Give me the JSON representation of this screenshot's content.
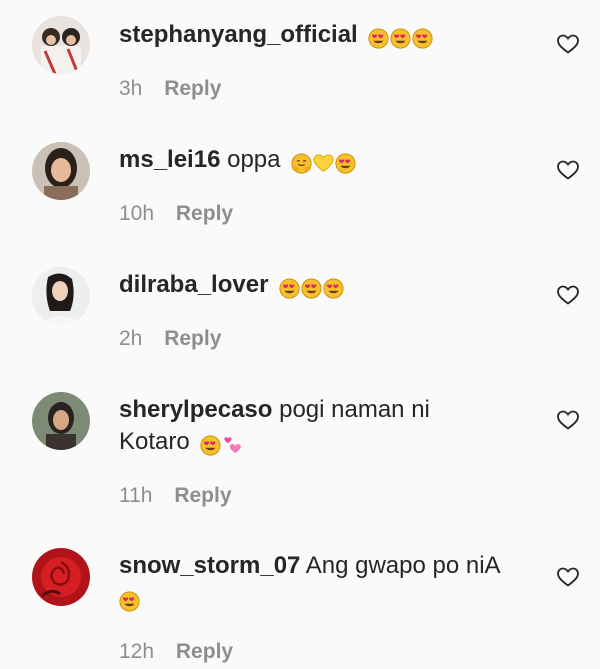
{
  "comments": [
    {
      "username": "stephanyang_official",
      "text": "",
      "emojis": [
        "heart-eyes-emoji",
        "heart-eyes-emoji",
        "heart-eyes-emoji"
      ],
      "time": "3h",
      "reply": "Reply"
    },
    {
      "username": "ms_lei16",
      "text": "oppa",
      "emojis": [
        "hugging-face-emoji",
        "yellow-heart-emoji",
        "heart-eyes-emoji"
      ],
      "time": "10h",
      "reply": "Reply"
    },
    {
      "username": "dilraba_lover",
      "text": "",
      "emojis": [
        "heart-eyes-emoji",
        "heart-eyes-emoji",
        "heart-eyes-emoji"
      ],
      "time": "2h",
      "reply": "Reply"
    },
    {
      "username": "sherylpecaso",
      "text": "pogi naman ni",
      "text2": "Kotaro",
      "emojis": [
        "heart-eyes-emoji",
        "two-hearts-emoji"
      ],
      "time": "11h",
      "reply": "Reply"
    },
    {
      "username": "snow_storm_07",
      "text": "Ang gwapo po niA",
      "emojis": [
        "heart-eyes-emoji"
      ],
      "time": "12h",
      "reply": "Reply"
    }
  ],
  "colors": {
    "background": "#fafafa",
    "text": "#262626",
    "meta": "#8e8e8e",
    "heart_outline": "#262626",
    "emoji_face": "#f5c02b",
    "emoji_heart": "#e0245e"
  },
  "icons": {
    "like": "heart-outline-icon"
  }
}
